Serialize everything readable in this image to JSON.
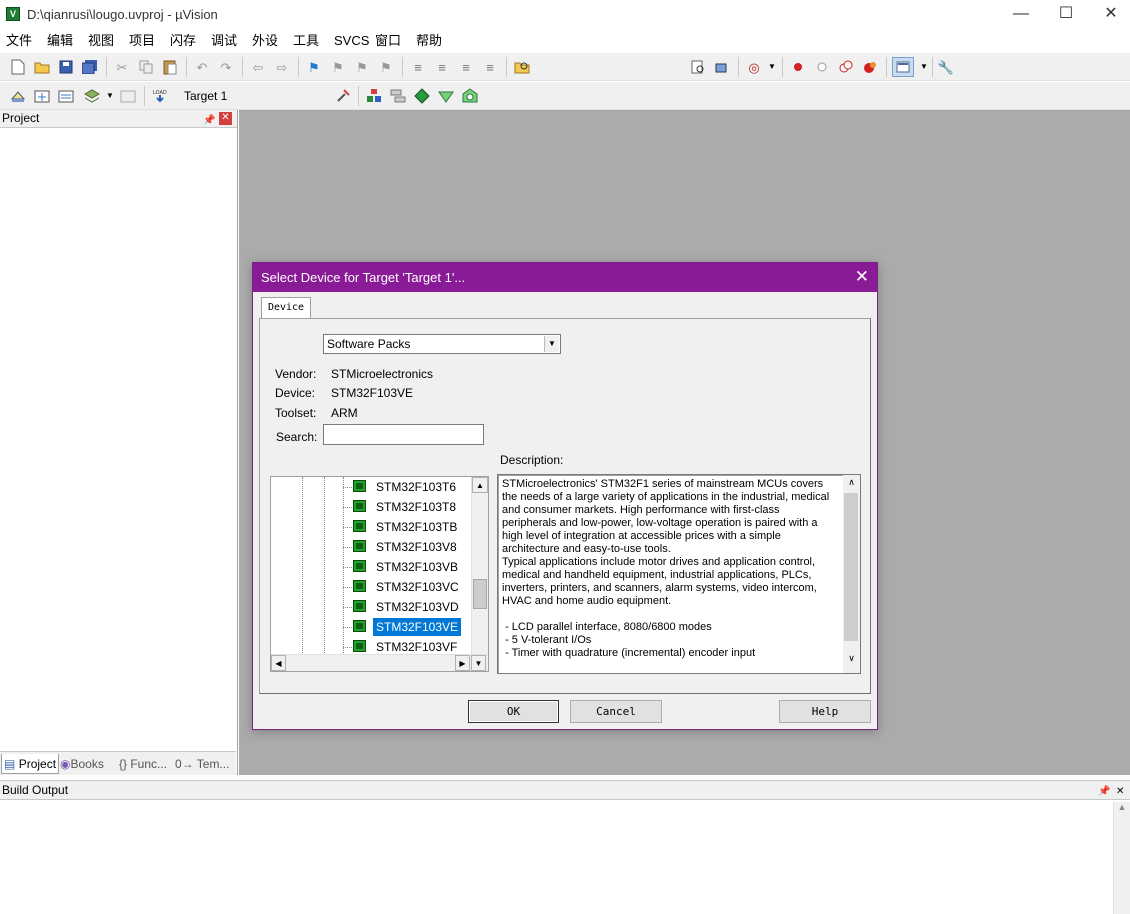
{
  "window": {
    "title": "D:\\qianrusi\\lougo.uvproj - µVision",
    "app_icon": "V"
  },
  "menu": [
    "文件",
    "编辑",
    "视图",
    "项目",
    "闪存",
    "调试",
    "外设",
    "工具",
    "SVCS",
    "窗口",
    "帮助"
  ],
  "toolbar2": {
    "target_label": "Target 1"
  },
  "project_pane": {
    "title": "Project",
    "tabs": [
      "Project",
      "Books",
      "{} Func...",
      "0→ Tem..."
    ]
  },
  "build_output": {
    "title": "Build Output"
  },
  "dialog": {
    "title": "Select Device for Target 'Target 1'...",
    "tab": "Device",
    "source_combo": "Software Packs",
    "vendor_label": "Vendor:",
    "vendor": "STMicroelectronics",
    "device_label": "Device:",
    "device": "STM32F103VE",
    "toolset_label": "Toolset:",
    "toolset": "ARM",
    "search_label": "Search:",
    "search_value": "",
    "description_label": "Description:",
    "device_list": [
      "STM32F103T6",
      "STM32F103T8",
      "STM32F103TB",
      "STM32F103V8",
      "STM32F103VB",
      "STM32F103VC",
      "STM32F103VD",
      "STM32F103VE",
      "STM32F103VF"
    ],
    "selected_device": "STM32F103VE",
    "description": "STMicroelectronics' STM32F1 series of mainstream MCUs covers the needs of a large variety of applications in the industrial, medical and consumer markets. High performance with first-class peripherals and low-power, low-voltage operation is paired with a high level of integration at accessible prices with a simple architecture and easy-to-use tools.\nTypical applications include motor drives and application control, medical and handheld equipment, industrial applications, PLCs, inverters, printers, and scanners, alarm systems, video intercom, HVAC and home audio equipment.\n\n - LCD parallel interface, 8080/6800 modes\n - 5 V-tolerant I/Os\n - Timer with quadrature (incremental) encoder input",
    "buttons": {
      "ok": "OK",
      "cancel": "Cancel",
      "help": "Help"
    }
  },
  "colors": {
    "dialog_title": "#8a1b96",
    "selection": "#0078d7",
    "workspace": "#ababab"
  }
}
